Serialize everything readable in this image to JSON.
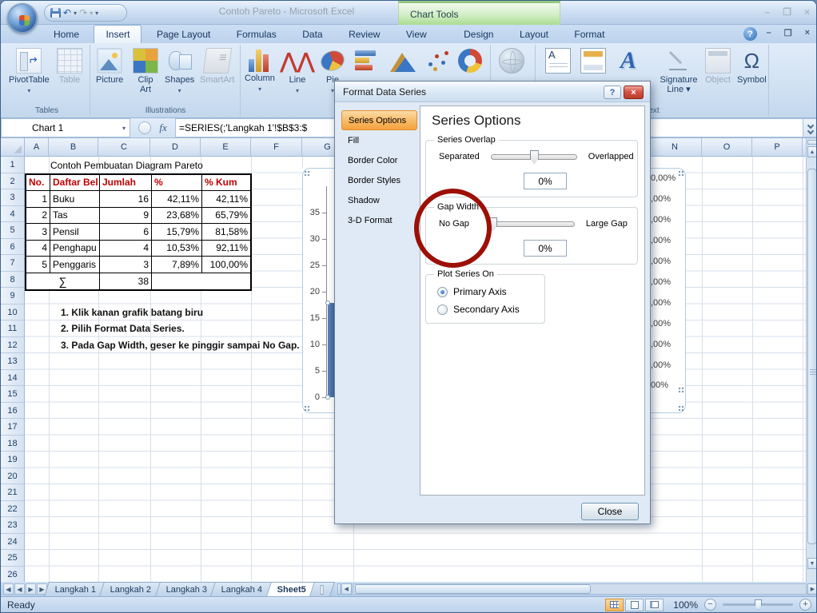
{
  "colors": {
    "table_header_red": "#c00000",
    "bar_blue": "#4a7ab5",
    "red_circle": "#9c1006",
    "nav_selected_orange": "#f5a13c",
    "chart_tools_green": "#abdc92"
  },
  "icons": {
    "dropdown_arrow": "▾",
    "undo": "↶",
    "redo": "↷",
    "window_minimize": "–",
    "window_restore": "❐",
    "window_close": "×",
    "help": "?",
    "fx": "fx",
    "tab_first": "◀",
    "tab_prev": "◀",
    "tab_next": "▶",
    "tab_last": "▶",
    "scroll_left": "◀",
    "scroll_right": "▶",
    "scroll_up": "▲",
    "scroll_down": "▼",
    "zoom_out": "−",
    "zoom_in": "+",
    "omega": "Ω"
  },
  "title_bar": {
    "title": "Contoh Pareto - Microsoft Excel",
    "context_label": "Chart Tools"
  },
  "ribbon_tabs": [
    "Home",
    "Insert",
    "Page Layout",
    "Formulas",
    "Data",
    "Review",
    "View",
    "Design",
    "Layout",
    "Format"
  ],
  "ribbon": {
    "group_labels": {
      "tables": "Tables",
      "illustrations": "Illustrations",
      "text": "Text"
    },
    "buttons": {
      "pivottable": "PivotTable",
      "table": "Table",
      "picture": "Picture",
      "clipart": "Clip\nArt",
      "shapes": "Shapes",
      "smartart": "SmartArt",
      "column": "Column",
      "line": "Line",
      "pie": "Pie",
      "signature": "Signature\nLine ▾",
      "object": "Object",
      "symbol": "Symbol"
    }
  },
  "formula_bar": {
    "name_box": "Chart 1",
    "formula": "=SERIES(;'Langkah 1'!$B$3:$"
  },
  "grid": {
    "columns_left": [
      "A",
      "B",
      "C",
      "D",
      "E",
      "F",
      "G"
    ],
    "columns_right": [
      "N",
      "O",
      "P"
    ],
    "rows": [
      "1",
      "2",
      "3",
      "4",
      "5",
      "6",
      "7",
      "8",
      "9",
      "10",
      "11",
      "12",
      "13",
      "14",
      "15",
      "16",
      "17",
      "18",
      "19",
      "20",
      "21",
      "22",
      "23",
      "24",
      "25",
      "26"
    ]
  },
  "sheet": {
    "title_cell": "Contoh Pembuatan Diagram Pareto",
    "table": {
      "headers": [
        "No.",
        "Daftar Bel",
        "Jumlah",
        "%",
        "% Kum"
      ],
      "rows": [
        [
          "1",
          "Buku",
          "16",
          "42,11%",
          "42,11%"
        ],
        [
          "2",
          "Tas",
          "9",
          "23,68%",
          "65,79%"
        ],
        [
          "3",
          "Pensil",
          "6",
          "15,79%",
          "81,58%"
        ],
        [
          "4",
          "Penghapu",
          "4",
          "10,53%",
          "92,11%"
        ],
        [
          "5",
          "Penggaris",
          "3",
          "7,89%",
          "100,00%"
        ]
      ],
      "sum_symbol": "∑",
      "sum_value": "38"
    },
    "instructions": [
      "1. Klik kanan grafik batang biru",
      "2. Pilih Format Data Series.",
      "3. Pada Gap Width, geser ke pinggir sampai No Gap."
    ]
  },
  "chart": {
    "left_axis_labels": [
      "35",
      "30",
      "25",
      "20",
      "15",
      "10",
      "5",
      "0"
    ],
    "right_axis_labels": [
      "0,00%",
      ",00%",
      ",00%",
      ",00%",
      ",00%",
      ",00%",
      ",00%",
      ",00%",
      ",00%",
      ",00%",
      "00%"
    ]
  },
  "dialog": {
    "title": "Format Data Series",
    "nav": [
      "Series Options",
      "Fill",
      "Border Color",
      "Border Styles",
      "Shadow",
      "3-D Format"
    ],
    "heading": "Series Options",
    "series_overlap": {
      "label": "Series Overlap",
      "min_label": "Separated",
      "max_label": "Overlapped",
      "value": "0%"
    },
    "gap_width": {
      "label": "Gap Width",
      "min_label": "No Gap",
      "max_label": "Large Gap",
      "value": "0%"
    },
    "plot_series_on": {
      "label": "Plot Series On",
      "primary": "Primary Axis",
      "secondary": "Secondary Axis"
    },
    "close_label": "Close"
  },
  "sheet_tabs": [
    "Langkah 1",
    "Langkah 2",
    "Langkah 3",
    "Langkah 4",
    "Sheet5"
  ],
  "status_bar": {
    "ready": "Ready",
    "zoom_level": "100%"
  }
}
